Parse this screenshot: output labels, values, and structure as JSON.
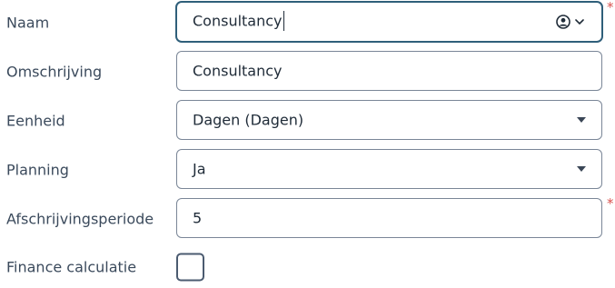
{
  "form": {
    "fields": [
      {
        "label": "Naam",
        "value": "Consultancy",
        "required_mark": "*",
        "icons": [
          "user-circle-icon",
          "chevron-down-icon"
        ]
      },
      {
        "label": "Omschrijving",
        "value": "Consultancy"
      },
      {
        "label": "Eenheid",
        "value": "Dagen (Dagen)",
        "icons": [
          "dropdown-arrow-icon"
        ]
      },
      {
        "label": "Planning",
        "value": "Ja",
        "icons": [
          "dropdown-arrow-icon"
        ]
      },
      {
        "label": "Afschrijvingsperiode",
        "value": "5",
        "required_mark": "*"
      },
      {
        "label": "Finance calculatie",
        "checked": false
      }
    ]
  },
  "colors": {
    "required": "#d9534f",
    "border": "#7a8697",
    "focus_border": "#2f5f7a",
    "text": "#1f2b38",
    "label": "#3b4a5c"
  }
}
